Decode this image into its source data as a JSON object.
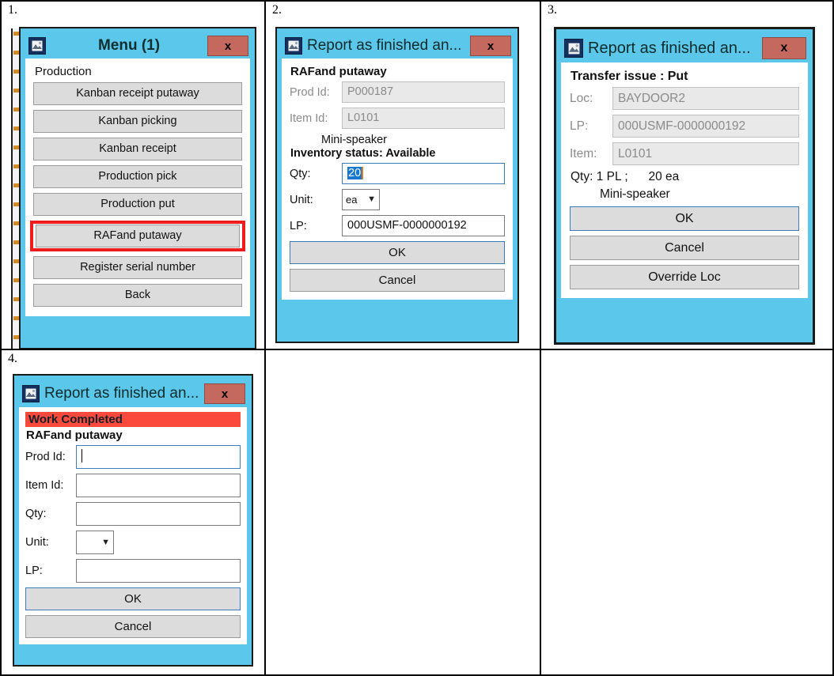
{
  "panels": [
    {
      "number": "1.",
      "window": {
        "title": "Menu (1)",
        "icon": "app-picture-icon",
        "close_label": "x"
      },
      "section_label": "Production",
      "menu_items": [
        "Kanban receipt putaway",
        "Kanban picking",
        "Kanban receipt",
        "Production pick",
        "Production put",
        "RAFand putaway",
        "Register serial number",
        "Back"
      ],
      "highlighted_item": "RAFand putaway"
    },
    {
      "number": "2.",
      "window": {
        "title": "Report as finished an...",
        "icon": "app-picture-icon",
        "close_label": "x"
      },
      "form_title": "RAFand putaway",
      "fields": [
        {
          "label": "Prod Id:",
          "value": "P000187",
          "state": "disabled"
        },
        {
          "label": "Item Id:",
          "value": "L0101",
          "state": "disabled"
        }
      ],
      "item_name": "Mini-speaker",
      "inventory_status": "Inventory status: Available",
      "qty_label": "Qty:",
      "qty_value": "20",
      "unit_label": "Unit:",
      "unit_value": "ea",
      "lp_label": "LP:",
      "lp_value": "000USMF-0000000192",
      "buttons": [
        "OK",
        "Cancel"
      ]
    },
    {
      "number": "3.",
      "window": {
        "title": "Report as finished an...",
        "icon": "app-picture-icon",
        "close_label": "x"
      },
      "form_title": "Transfer issue : Put",
      "fields": [
        {
          "label": "Loc:",
          "value": "BAYDOOR2",
          "state": "disabled"
        },
        {
          "label": "LP:",
          "value": "000USMF-0000000192",
          "state": "disabled"
        },
        {
          "label": "Item:",
          "value": "L0101",
          "state": "disabled"
        }
      ],
      "qty_line": "Qty: 1 PL ;      20 ea",
      "item_name": "Mini-speaker",
      "buttons": [
        "OK",
        "Cancel",
        "Override Loc"
      ]
    },
    {
      "number": "4.",
      "window": {
        "title": "Report as finished an...",
        "icon": "app-picture-icon",
        "close_label": "x"
      },
      "banner": "Work Completed",
      "form_title": "RAFand putaway",
      "fields": [
        {
          "label": "Prod Id:",
          "value": "",
          "state": "focused"
        },
        {
          "label": "Item Id:",
          "value": "",
          "state": "empty"
        },
        {
          "label": "Qty:",
          "value": "",
          "state": "empty"
        }
      ],
      "unit_label": "Unit:",
      "unit_value": "",
      "lp_label": "LP:",
      "lp_value": "",
      "buttons": [
        "OK",
        "Cancel"
      ]
    },
    {
      "number": "",
      "empty": true
    },
    {
      "number": "",
      "empty": true
    }
  ],
  "colors": {
    "window_frame": "#5BC8EB",
    "close_button": "#c5695e",
    "highlight_red": "#ee1c1c",
    "banner_red": "#fb4a3c",
    "button_face": "#dcdcdc",
    "selection_blue": "#1477d1",
    "caret_orange": "#e07b20"
  }
}
